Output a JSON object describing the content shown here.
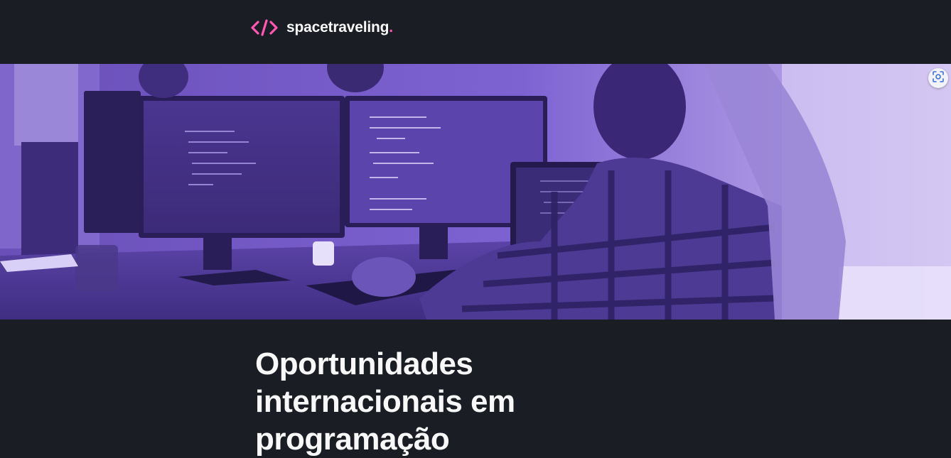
{
  "header": {
    "logo_text": "spacetraveling",
    "logo_dot": ".",
    "logo_icon": "code-brackets-icon",
    "accent_color": "#ff57b2"
  },
  "banner": {
    "image_name": "developers-at-computers-banner",
    "tint_color": "#7b5cd6"
  },
  "screenshot_button": {
    "icon": "screenshot-capture-icon"
  },
  "post": {
    "title": "Oportunidades internacionais em programação"
  }
}
